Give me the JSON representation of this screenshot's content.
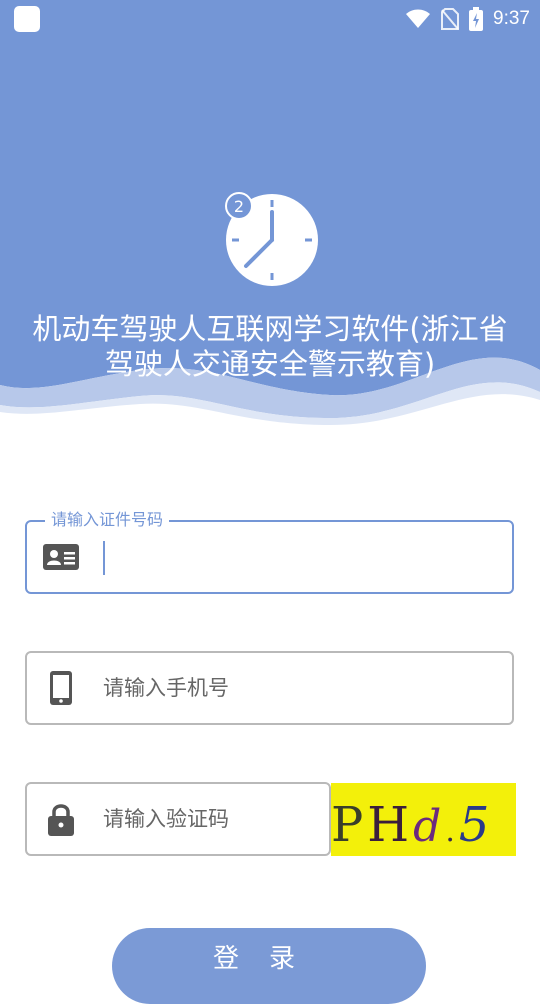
{
  "status_bar": {
    "time": "9:37"
  },
  "header": {
    "title": "机动车驾驶人互联网学习软件(浙江省驾驶人交通安全警示教育)",
    "clock_badge": "2",
    "colors": {
      "primary": "#7496d6",
      "wave_light": "#b7c8ea"
    }
  },
  "form": {
    "id_field": {
      "legend": "请输入证件号码",
      "value": ""
    },
    "phone_field": {
      "placeholder": "请输入手机号"
    },
    "captcha_field": {
      "placeholder": "请输入验证码"
    },
    "captcha": {
      "text": "PHd.5"
    }
  },
  "login_button": {
    "label": "登录"
  }
}
